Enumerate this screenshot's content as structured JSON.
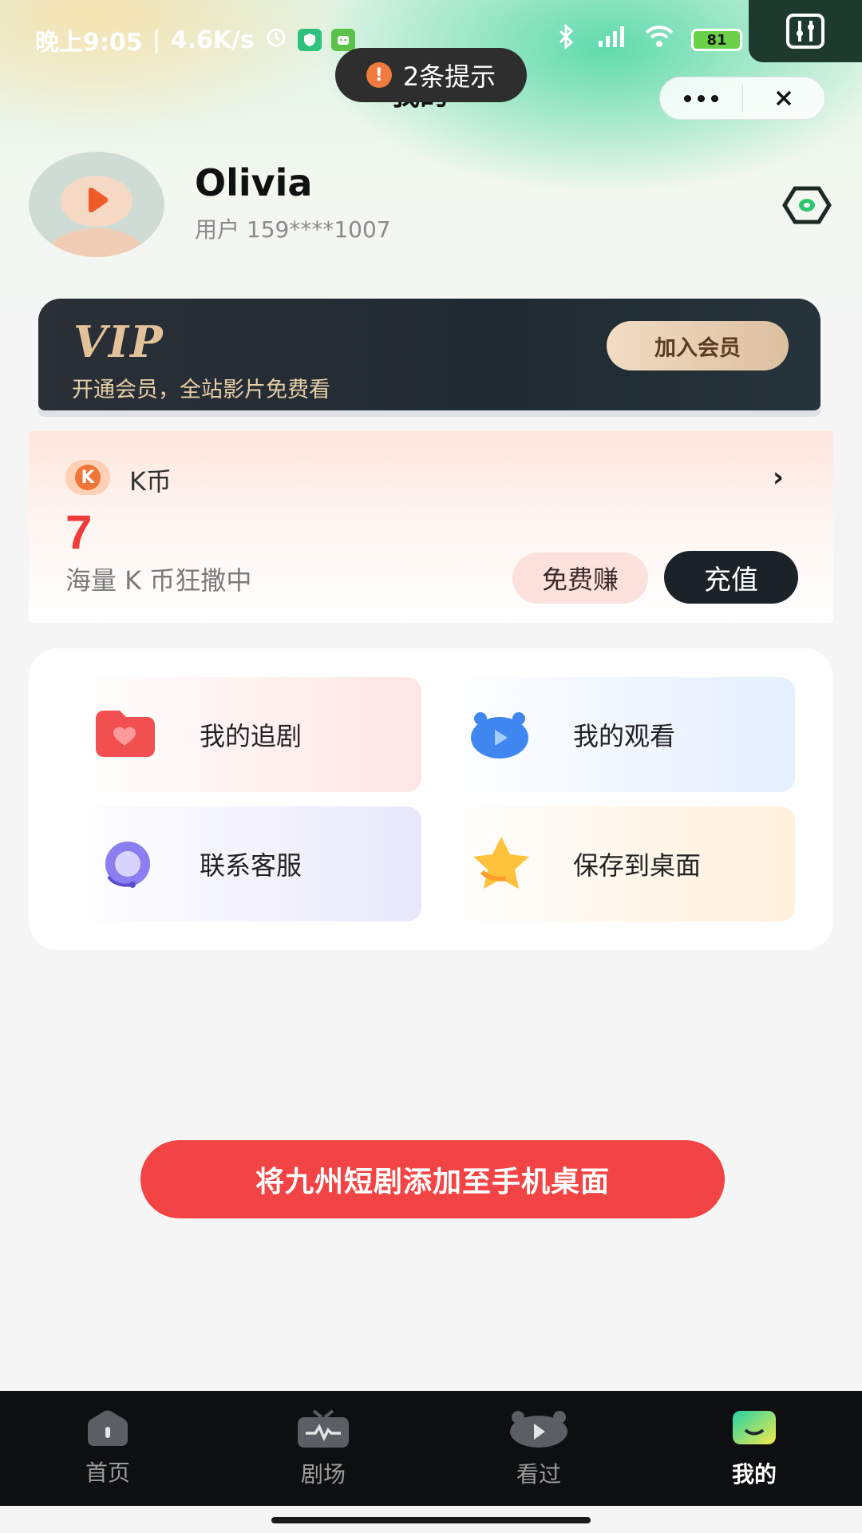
{
  "status_bar": {
    "time": "晚上9:05",
    "speed": "4.6K/s",
    "battery": "81"
  },
  "toast": {
    "icon": "!",
    "text": "2条提示"
  },
  "header": {
    "title": "我的"
  },
  "profile": {
    "name": "Olivia",
    "user_id": "用户 159****1007"
  },
  "vip": {
    "logo": "VIP",
    "description": "开通会员，全站影片免费看",
    "join_label": "加入会员"
  },
  "kcoin": {
    "label": "K币",
    "icon_letter": "K",
    "value": "7",
    "description": "海量 K 币狂撒中",
    "free_label": "免费赚",
    "charge_label": "充值",
    "arrow": "›"
  },
  "features": [
    {
      "label": "我的追剧",
      "icon": "heart-folder-icon"
    },
    {
      "label": "我的观看",
      "icon": "watch-history-icon"
    },
    {
      "label": "联系客服",
      "icon": "headset-icon"
    },
    {
      "label": "保存到桌面",
      "icon": "star-icon"
    }
  ],
  "add_desktop": {
    "label": "将九州短剧添加至手机桌面"
  },
  "nav": [
    {
      "label": "首页",
      "icon": "home-icon",
      "active": false
    },
    {
      "label": "剧场",
      "icon": "tv-icon",
      "active": false
    },
    {
      "label": "看过",
      "icon": "history-icon",
      "active": false
    },
    {
      "label": "我的",
      "icon": "profile-icon",
      "active": true
    }
  ],
  "colors": {
    "accent_red": "#f24444",
    "vip_gold": "#e3c29a",
    "nav_bg": "#0e0f11"
  }
}
